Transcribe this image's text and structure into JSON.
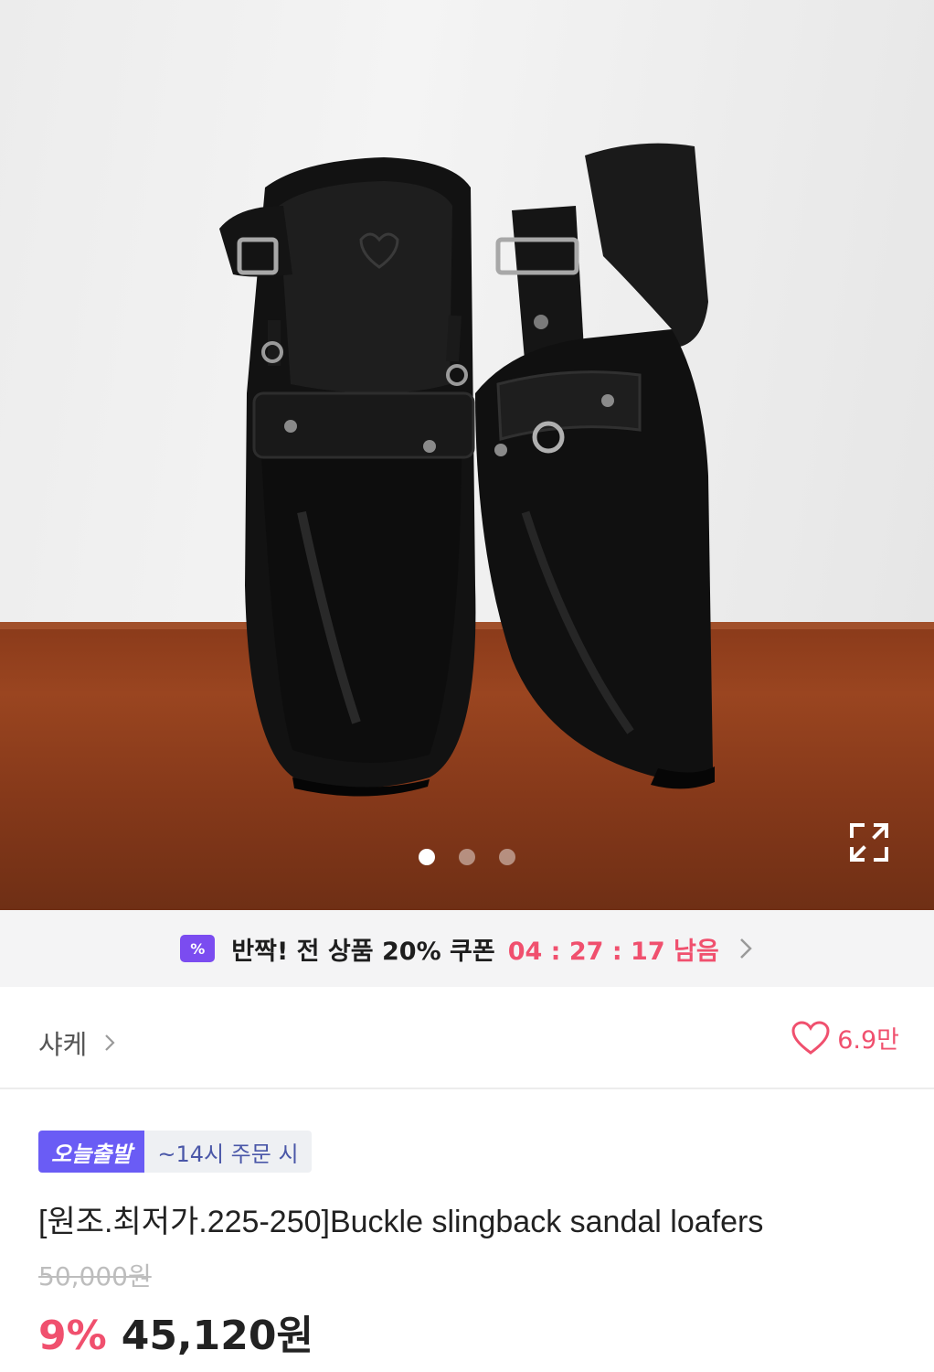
{
  "carousel": {
    "pages": [
      {
        "active": true
      },
      {
        "active": false
      },
      {
        "active": false
      }
    ],
    "expand_icon": "expand-arrows-icon"
  },
  "coupon_banner": {
    "icon_text": "%",
    "icon": "coupon-percent-icon",
    "text": "반짝! 전 상품 20% 쿠폰",
    "timer": "04 : 27 : 17 남음",
    "chevron_icon": "chevron-right-icon"
  },
  "seller": {
    "name": "샤케",
    "like_count": "6.9만",
    "like_icon": "heart-outline-icon"
  },
  "product": {
    "badge_primary": "오늘출발",
    "badge_secondary": "~14시 주문 시",
    "title": "[원조.최저가.225-250]Buckle slingback sandal loafers",
    "original_price": "50,000원",
    "discount": "9%",
    "price": "45,120원"
  },
  "colors": {
    "accent": "#f0506e",
    "badge": "#6a5cf5",
    "coupon_icon": "#7b4cf0"
  }
}
